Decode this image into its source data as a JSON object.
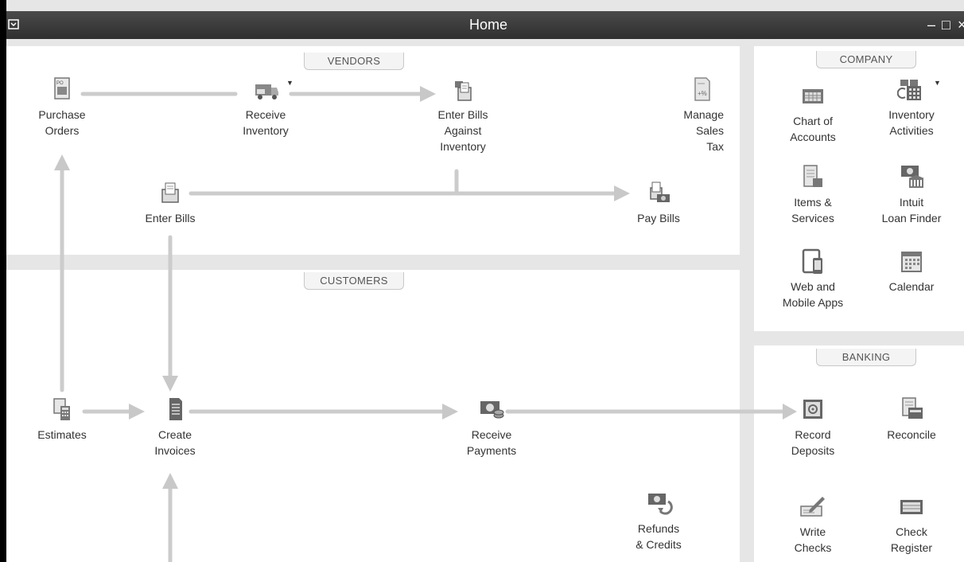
{
  "window": {
    "title": "Home",
    "controls": {
      "minimize": "–",
      "maximize": "□",
      "close": "×"
    }
  },
  "vendors": {
    "tab_label": "VENDORS",
    "items": {
      "purchase_orders": "Purchase\nOrders",
      "receive_inventory": "Receive\nInventory",
      "enter_bills_against_inventory": "Enter Bills\nAgainst\nInventory",
      "manage_sales_tax": "Manage\nSales\nTax",
      "enter_bills": "Enter Bills",
      "pay_bills": "Pay Bills"
    }
  },
  "customers": {
    "tab_label": "CUSTOMERS",
    "items": {
      "estimates": "Estimates",
      "create_invoices": "Create\nInvoices",
      "receive_payments": "Receive\nPayments",
      "refunds_credits": "Refunds\n& Credits"
    }
  },
  "company": {
    "tab_label": "COMPANY",
    "items": {
      "chart_of_accounts": "Chart of\nAccounts",
      "inventory_activities": "Inventory\nActivities",
      "items_services": "Items &\nServices",
      "intuit_loan_finder": "Intuit\nLoan Finder",
      "web_mobile_apps": "Web and\nMobile Apps",
      "calendar": "Calendar"
    }
  },
  "banking": {
    "tab_label": "BANKING",
    "items": {
      "record_deposits": "Record\nDeposits",
      "reconcile": "Reconcile",
      "write_checks": "Write\nChecks",
      "check_register": "Check\nRegister"
    }
  },
  "colors": {
    "titlebar": "#3a3a3a",
    "background": "#e6e6e6",
    "panel": "#ffffff",
    "flow_arrow": "#c8c8c8",
    "icon_gray": "#7a7a7a"
  }
}
